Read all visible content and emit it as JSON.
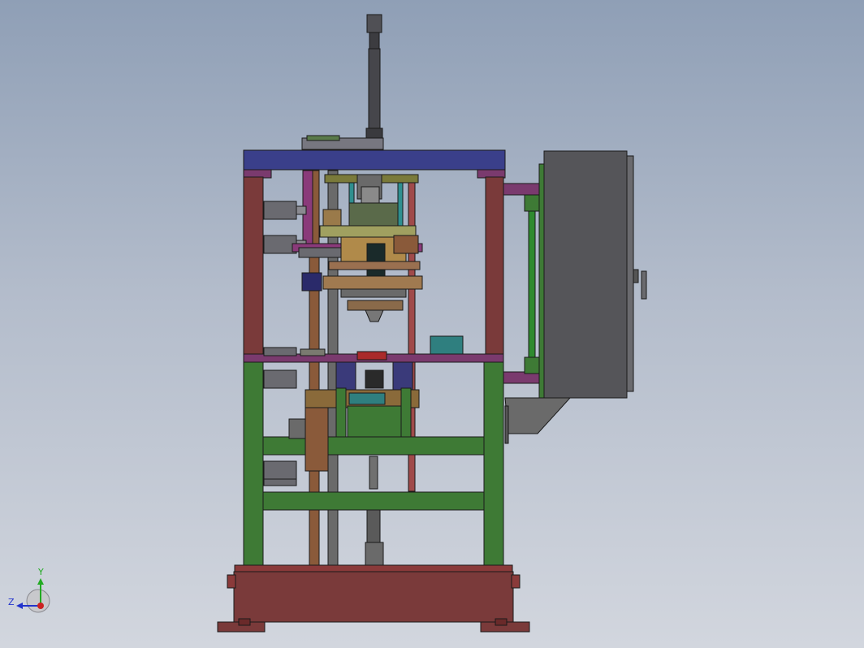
{
  "colors": {
    "background_top": "#8f9fb6",
    "background_bottom": "#d2d6de",
    "frame_red": "#7a3a3a",
    "frame_green": "#3e7a35",
    "top_plate_blue": "#3a3f8a",
    "control_cabinet": "#555559",
    "purple_bracket": "#7a3a6e",
    "axis_x": "#cc2222",
    "axis_y": "#22aa22",
    "axis_z": "#2233cc"
  },
  "view": {
    "triad": {
      "y_label": "Y",
      "z_label": "Z",
      "x_origin": "red-dot"
    }
  },
  "icons": [
    "coordinate-triad-icon"
  ]
}
